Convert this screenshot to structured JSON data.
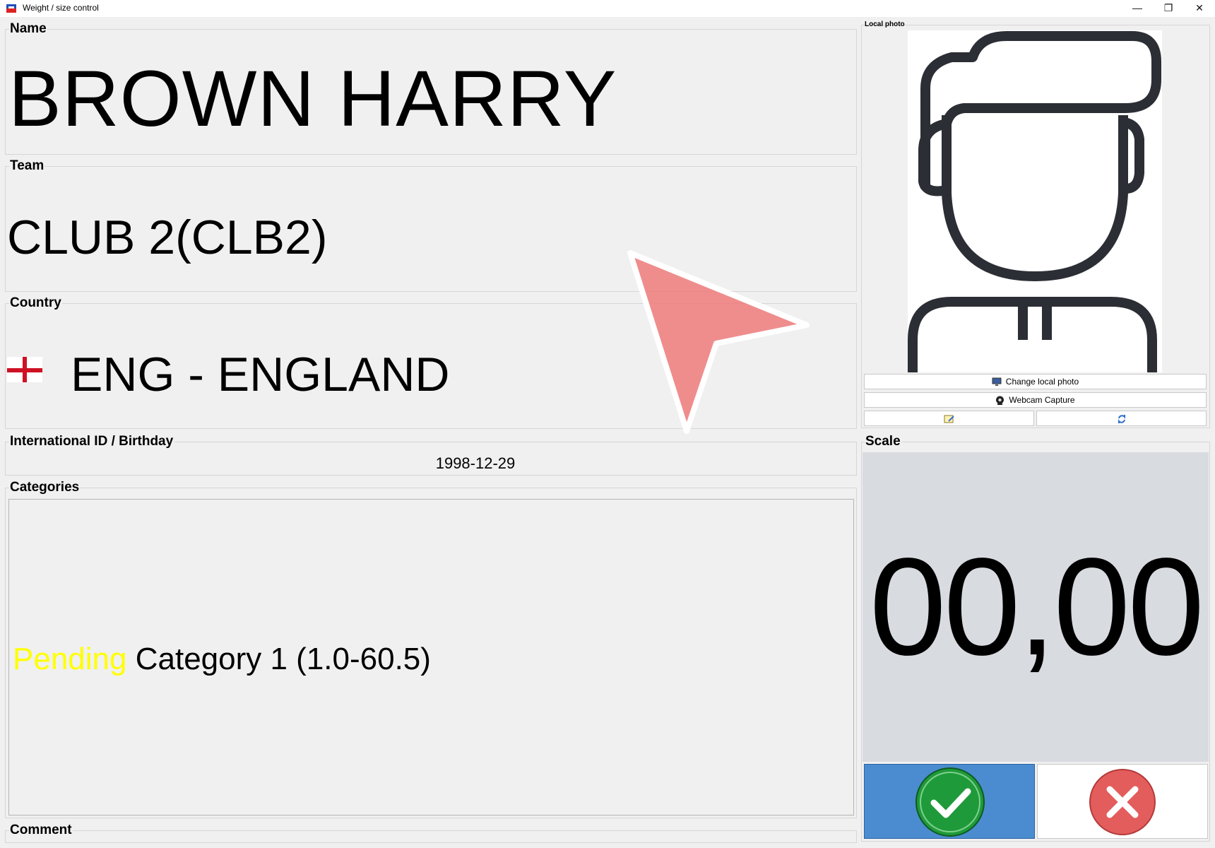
{
  "window": {
    "title": "Weight / size control",
    "min_glyph": "—",
    "max_glyph": "❐",
    "close_glyph": "✕"
  },
  "fields": {
    "name": {
      "label": "Name",
      "value": "BROWN HARRY"
    },
    "team": {
      "label": "Team",
      "value": "CLUB 2(CLB2)"
    },
    "country": {
      "label": "Country",
      "value": "ENG - ENGLAND",
      "flag": "england-flag"
    },
    "intl_id": {
      "label": "International ID / Birthday",
      "value": "1998-12-29"
    },
    "categories": {
      "label": "Categories",
      "status": "Pending",
      "status_color": "#ffff00",
      "entry": "Category 1 (1.0-60.5)"
    },
    "comment": {
      "label": "Comment"
    }
  },
  "photo": {
    "label": "Local photo",
    "change_label": "Change local photo",
    "webcam_label": "Webcam Capture"
  },
  "scale": {
    "label": "Scale",
    "value": "00,00"
  },
  "colors": {
    "accept_bg": "#4a8ccf",
    "accept_icon": "#1f9a3a",
    "cancel_icon": "#e35d5d",
    "scale_bg": "#d8dbe0"
  }
}
